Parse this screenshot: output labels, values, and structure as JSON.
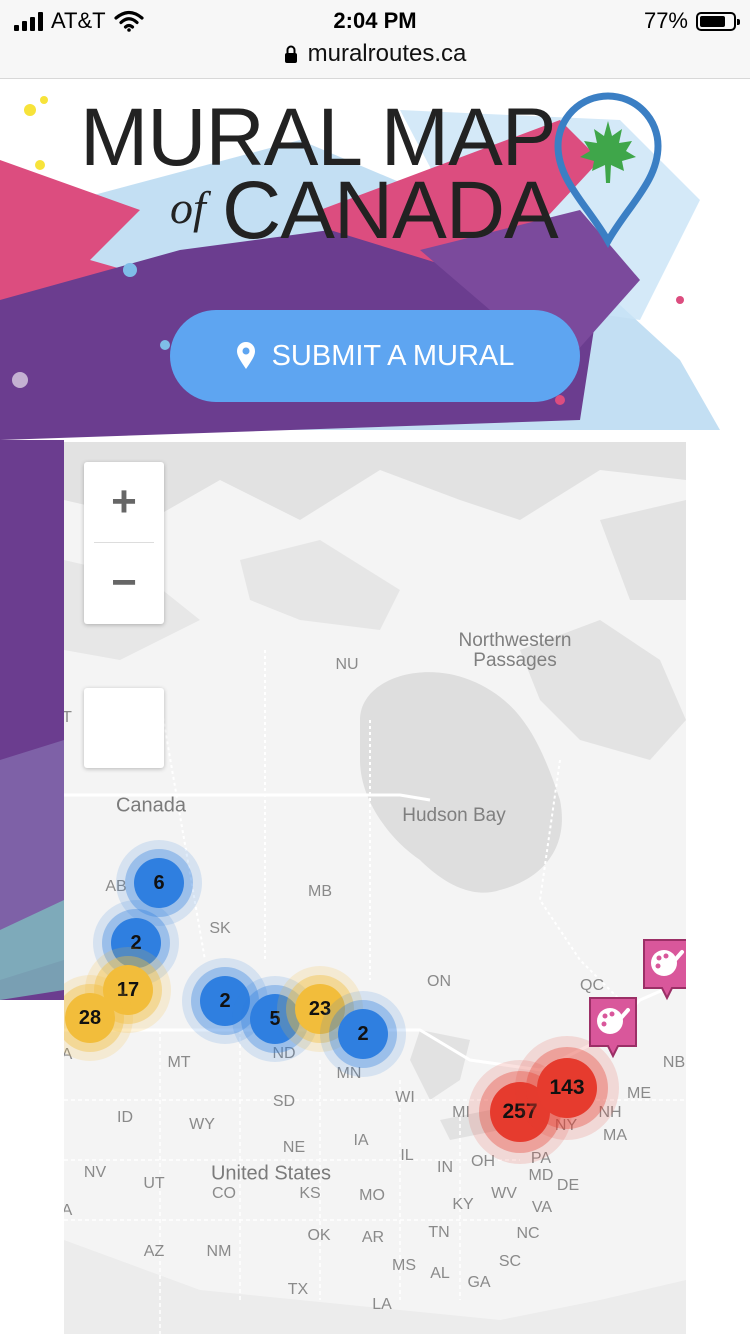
{
  "status_bar": {
    "carrier": "AT&T",
    "time": "2:04 PM",
    "battery": "77%",
    "url": "muralroutes.ca"
  },
  "logo": {
    "line1": "MURAL MAP",
    "of": "of",
    "line2": "CANADA"
  },
  "submit_button": {
    "label": "SUBMIT A MURAL"
  },
  "colors": {
    "accent_blue": "#5ea5f1",
    "cluster_blue": "#2f7fe0",
    "cluster_yellow": "#f2bd3b",
    "cluster_red": "#e63b2e",
    "pin_pink": "#d9579b",
    "splash_pink": "#dc4d7f",
    "splash_purple": "#6b3d8f",
    "splash_lightblue": "#bcdcf2"
  },
  "map": {
    "zoom_in": "+",
    "zoom_out": "−",
    "labels": {
      "canada": "Canada",
      "nu": "NU",
      "northwestern": "Northwestern",
      "passages": "Passages",
      "hudson_bay": "Hudson Bay",
      "ab": "AB",
      "mb": "MB",
      "sk": "SK",
      "on": "ON",
      "qc": "QC",
      "nb": "NB",
      "me": "ME",
      "nh": "NH",
      "ma": "MA",
      "ny": "NY",
      "pa": "PA",
      "md": "MD",
      "de": "DE",
      "va": "VA",
      "nc": "NC",
      "sc": "SC",
      "ga": "GA",
      "al": "AL",
      "ms": "MS",
      "la": "LA",
      "tx": "TX",
      "ok": "OK",
      "ar": "AR",
      "tn": "TN",
      "ky": "KY",
      "wv": "WV",
      "oh": "OH",
      "in": "IN",
      "il": "IL",
      "mi": "MI",
      "wi": "WI",
      "mn": "MN",
      "ia": "IA",
      "mo": "MO",
      "ks": "KS",
      "ne": "NE",
      "sd": "SD",
      "nd": "ND",
      "mt": "MT",
      "wy": "WY",
      "id": "ID",
      "nv": "NV",
      "ut": "UT",
      "co": "CO",
      "az": "AZ",
      "nm": "NM",
      "united_states": "United States",
      "edge_t": "T",
      "edge_a": "A",
      "edge_a2": "A"
    },
    "clusters": {
      "c6": "6",
      "c2a": "2",
      "c17": "17",
      "c28": "28",
      "c2b": "2",
      "c5": "5",
      "c23": "23",
      "c2c": "2",
      "c257": "257",
      "c143": "143"
    }
  }
}
